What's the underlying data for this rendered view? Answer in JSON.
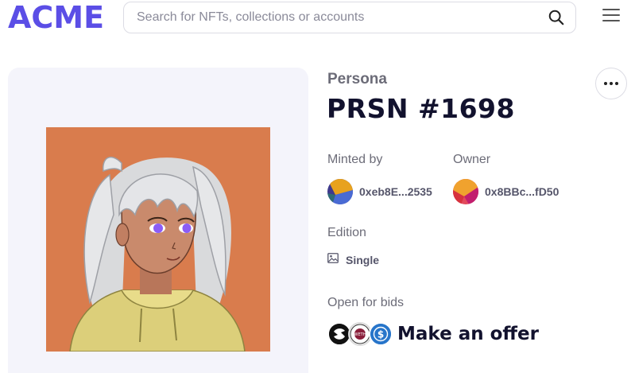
{
  "header": {
    "logo": "ACME",
    "search_placeholder": "Search for NFTs, collections or accounts",
    "search_value": ""
  },
  "nft": {
    "collection": "Persona",
    "title": "PRSN #1698",
    "minted_by_label": "Minted by",
    "minted_by_address": "0xeb8E...2535",
    "owner_label": "Owner",
    "owner_address": "0x8BBc...fD50",
    "edition_label": "Edition",
    "edition_value": "Single",
    "bids_label": "Open for bids",
    "bid_tokens": [
      "WETH",
      "USDC"
    ],
    "offer_label": "Make an offer"
  },
  "colors": {
    "brand": "#5b4ee6",
    "art_background": "#d97c4d",
    "panel_background": "#f4f4fb"
  },
  "icons": [
    "search-icon",
    "hamburger-menu-icon",
    "more-options-icon",
    "image-icon"
  ]
}
